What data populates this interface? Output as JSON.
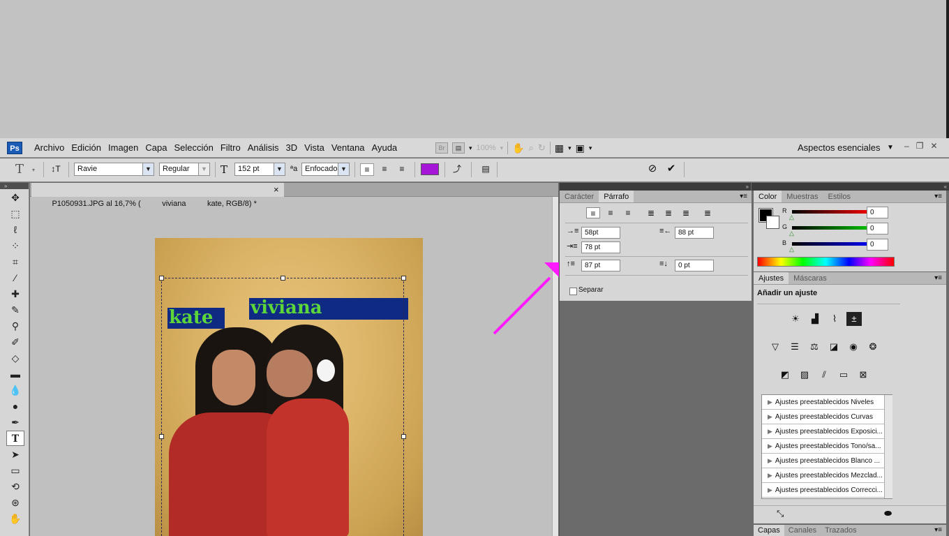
{
  "menubar": {
    "logo": "Ps",
    "items": [
      "Archivo",
      "Edición",
      "Imagen",
      "Capa",
      "Selección",
      "Filtro",
      "Análisis",
      "3D",
      "Vista",
      "Ventana",
      "Ayuda"
    ],
    "bridge": "Br",
    "zoom": "100%",
    "workspace": "Aspectos esenciales"
  },
  "options": {
    "font_family": "Ravie",
    "font_style": "Regular",
    "font_size": "152 pt",
    "antialias": "Enfocado",
    "text_color": "#a516d8"
  },
  "document": {
    "tab_title": "P1050931.JPG al 16,7% (          viviana          kate, RGB/8) *",
    "close": "×",
    "layer_texts": {
      "kate": "kate",
      "viviana": "viviana"
    }
  },
  "paragraph_panel": {
    "tabs": [
      "Carácter",
      "Párrafo"
    ],
    "active_tab": "Párrafo",
    "indent_left": "58pt",
    "indent_right": "88 pt",
    "indent_first": "78 pt",
    "space_before": "87 pt",
    "space_after": "0 pt",
    "hyphenate_label": "Separar"
  },
  "color_panel": {
    "tabs": [
      "Color",
      "Muestras",
      "Estilos"
    ],
    "channels": [
      {
        "label": "R",
        "value": "0",
        "color": "#ff0000"
      },
      {
        "label": "G",
        "value": "0",
        "color": "#00c000"
      },
      {
        "label": "B",
        "value": "0",
        "color": "#0000ff"
      }
    ]
  },
  "adjustments_panel": {
    "tabs": [
      "Ajustes",
      "Máscaras"
    ],
    "title": "Añadir un ajuste",
    "presets": [
      "Ajustes preestablecidos Niveles",
      "Ajustes preestablecidos Curvas",
      "Ajustes preestablecidos Exposici...",
      "Ajustes preestablecidos Tono/sa...",
      "Ajustes preestablecidos Blanco ...",
      "Ajustes preestablecidos Mezclad...",
      "Ajustes preestablecidos Correcci..."
    ]
  },
  "layers_tabs": [
    "Capas",
    "Canales",
    "Trazados"
  ]
}
